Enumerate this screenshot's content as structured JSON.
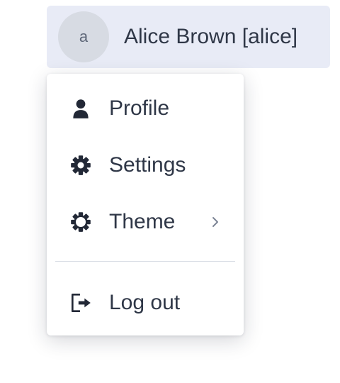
{
  "user": {
    "avatar_letter": "a",
    "display_name": "Alice Brown [alice]"
  },
  "menu": {
    "items": [
      {
        "label": "Profile",
        "icon": "user-icon"
      },
      {
        "label": "Settings",
        "icon": "gear-icon"
      },
      {
        "label": "Theme",
        "icon": "sun-icon",
        "submenu": true
      },
      {
        "label": "Log out",
        "icon": "logout-icon"
      }
    ]
  },
  "colors": {
    "trigger_background": "#e8ebf6",
    "avatar_background": "#d7dbe3",
    "text": "#2f3747",
    "icon": "#222836",
    "chevron": "#7d8596"
  }
}
